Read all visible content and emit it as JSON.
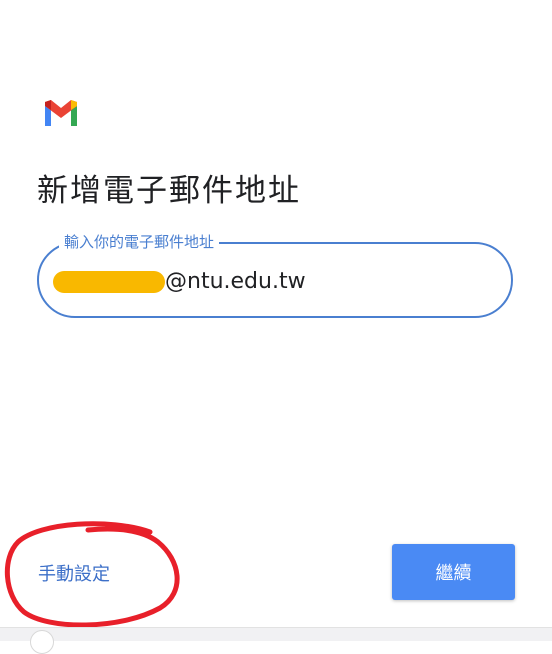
{
  "app": {
    "logo_icon": "gmail-logo-icon",
    "colors": {
      "accent": "#4a8af4",
      "field_border": "#4a7fd0",
      "link": "#3c6fc8",
      "annotation_circle": "#e8202a",
      "redaction": "#f9b800"
    }
  },
  "page": {
    "title": "新增電子郵件地址"
  },
  "email_field": {
    "label": "輸入你的電子郵件地址",
    "value_visible": "@ntu.edu.tw"
  },
  "footer": {
    "manual_setup_label": "手動設定",
    "continue_label": "繼續"
  }
}
